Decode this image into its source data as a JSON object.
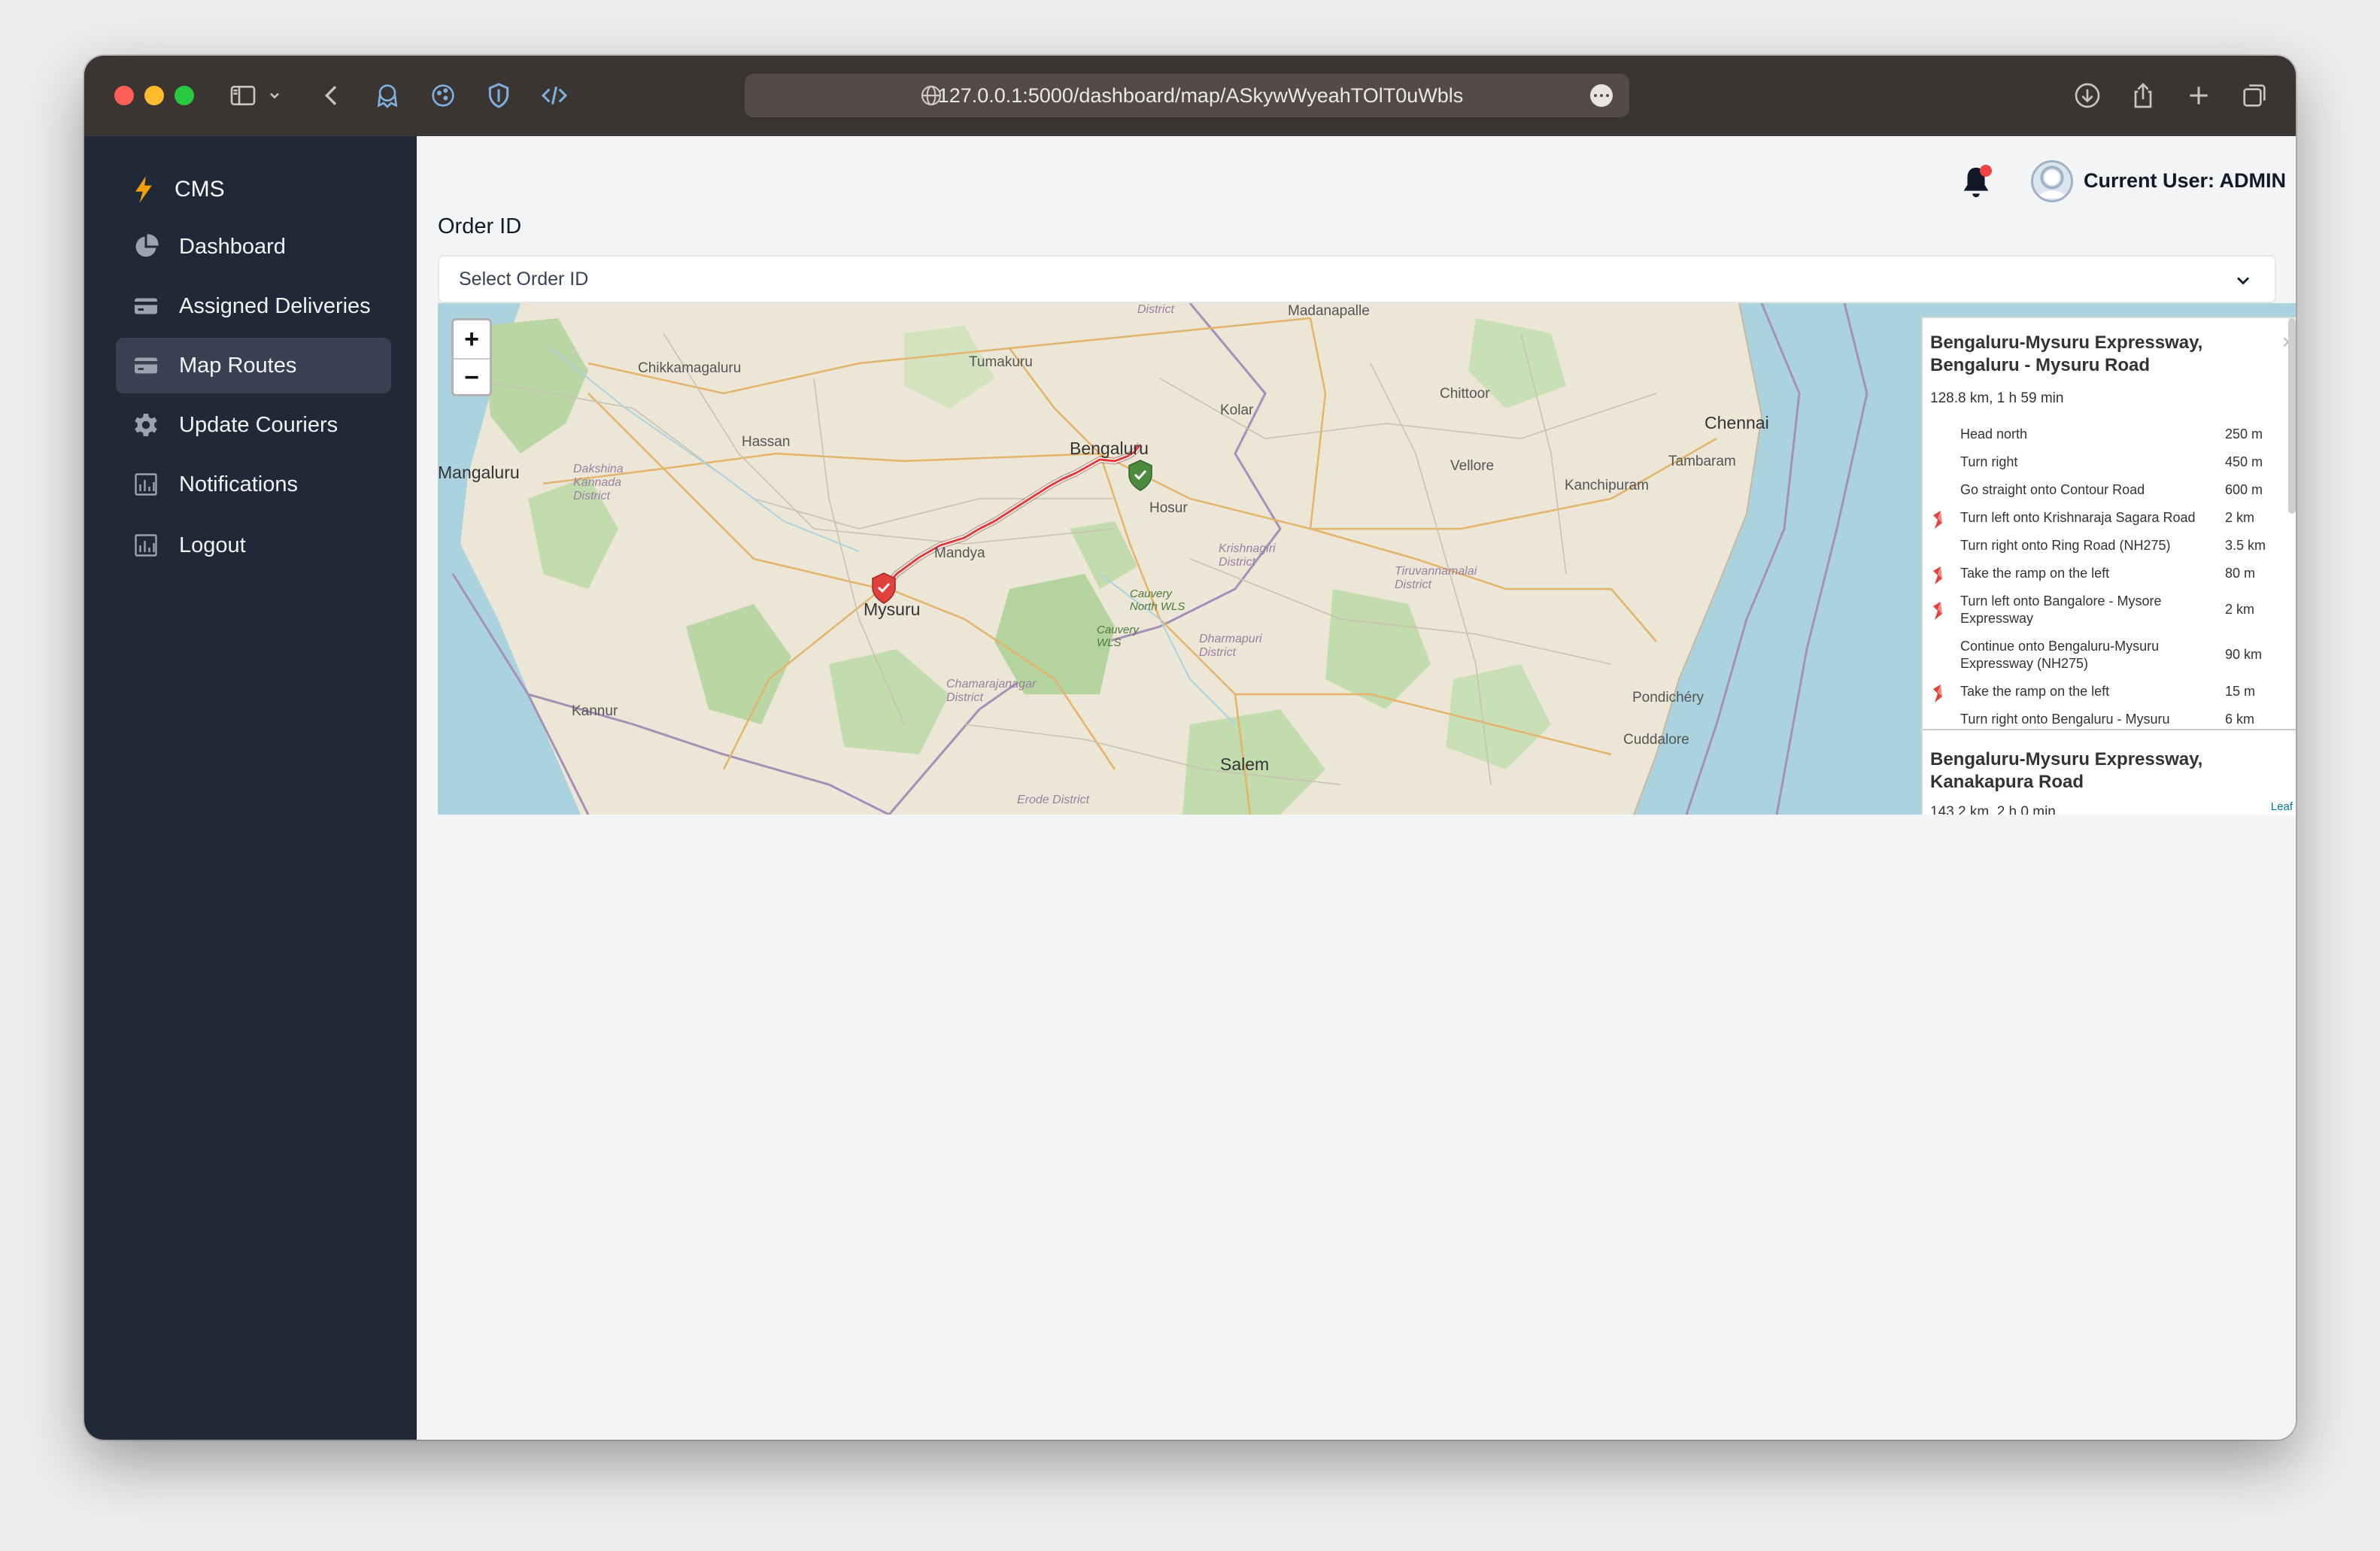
{
  "browser": {
    "url": "127.0.0.1:5000/dashboard/map/ASkywWyeahTOlT0uWbls"
  },
  "sidebar": {
    "brand": "CMS",
    "items": [
      {
        "label": "Dashboard",
        "icon": "pie-chart-icon"
      },
      {
        "label": "Assigned Deliveries",
        "icon": "card-icon"
      },
      {
        "label": "Map Routes",
        "icon": "card-icon",
        "active": true
      },
      {
        "label": "Update Couriers",
        "icon": "gear-icon"
      },
      {
        "label": "Notifications",
        "icon": "bar-chart-icon"
      },
      {
        "label": "Logout",
        "icon": "bar-chart-icon"
      }
    ]
  },
  "header": {
    "current_user": "Current User: ADMIN"
  },
  "form": {
    "order_label": "Order ID",
    "select_placeholder": "Select Order ID"
  },
  "map": {
    "zoom_in": "+",
    "zoom_out": "−",
    "labels": {
      "district_top": "District",
      "madanapalle": "Madanapalle",
      "chikkamagaluru": "Chikkamagaluru",
      "tumakuru": "Tumakuru",
      "bengaluru": "Bengaluru",
      "kolar": "Kolar",
      "chittoor": "Chittoor",
      "chennai": "Chennai",
      "hassan": "Hassan",
      "mangaluru": "Mangaluru",
      "dakshina": "Dakshina Kannada District",
      "hosur": "Hosur",
      "vellore": "Vellore",
      "kanchipuram": "Kanchipuram",
      "tambaram": "Tambaram",
      "mandya": "Mandya",
      "mysuru": "Mysuru",
      "krishnagiri": "Krishnagiri District",
      "tiruvannamalai": "Tiruvannamalai District",
      "cauvery_north": "Cauvery North WLS",
      "cauvery": "Cauvery WLS",
      "dharmapuri": "Dharmapuri District",
      "chamarajanagar": "Chamarajanagar District",
      "kannur": "Kannur",
      "pondicherry": "Pondichéry",
      "cuddalore": "Cuddalore",
      "salem": "Salem",
      "erode": "Erode District"
    },
    "attribution": "Leaf"
  },
  "routes": [
    {
      "name": "Bengaluru-Mysuru Expressway, Bengaluru - Mysuru Road",
      "summary": "128.8 km, 1 h 59 min",
      "steps": [
        {
          "text": "Head north",
          "distance": "250 m",
          "icon": ""
        },
        {
          "text": "Turn right",
          "distance": "450 m",
          "icon": ""
        },
        {
          "text": "Go straight onto Contour Road",
          "distance": "600 m",
          "icon": ""
        },
        {
          "text": "Turn left onto Krishnaraja Sagara Road",
          "distance": "2 km",
          "icon": "turn-left-icon"
        },
        {
          "text": "Turn right onto Ring Road (NH275)",
          "distance": "3.5 km",
          "icon": ""
        },
        {
          "text": "Take the ramp on the left",
          "distance": "80 m",
          "icon": "ramp-left-icon"
        },
        {
          "text": "Turn left onto Bangalore - Mysore Expressway",
          "distance": "2 km",
          "icon": "turn-left-icon"
        },
        {
          "text": "Continue onto Bengaluru-Mysuru Expressway (NH275)",
          "distance": "90 km",
          "icon": ""
        },
        {
          "text": "Take the ramp on the left",
          "distance": "15 m",
          "icon": "ramp-left-icon"
        },
        {
          "text": "Turn right onto Bengaluru - Mysuru",
          "distance": "6 km",
          "icon": ""
        }
      ]
    },
    {
      "name": "Bengaluru-Mysuru Expressway, Kanakapura Road",
      "summary": "143.2 km, 2 h 0 min"
    }
  ],
  "colors": {
    "sidebar_bg": "#1f2937",
    "active_item": "#374151",
    "route_line": "#e53935",
    "start_marker": "#4d8c3f",
    "end_marker": "#e0413a"
  }
}
